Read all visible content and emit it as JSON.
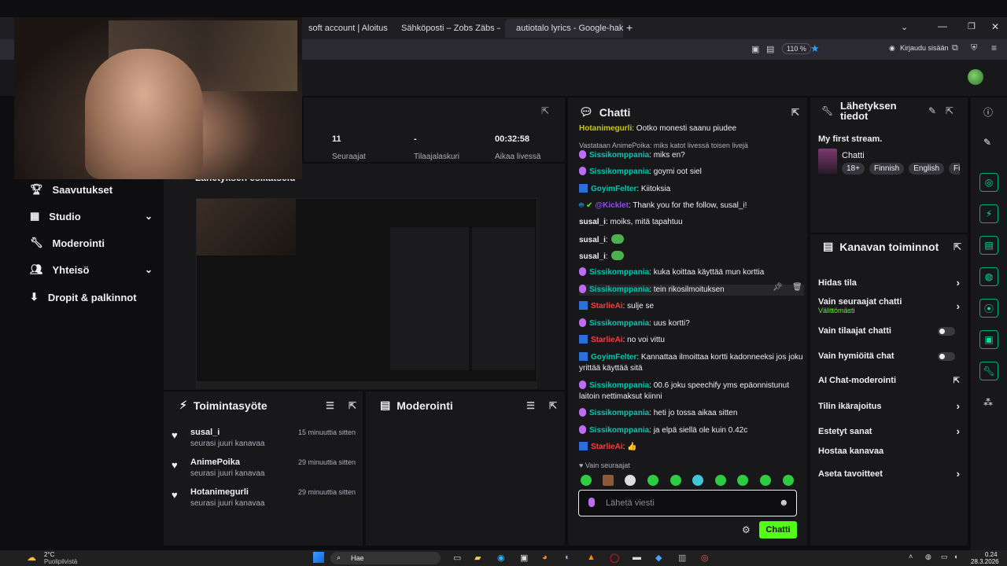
{
  "browser": {
    "tabs": [
      {
        "label": "soft account | Aloitus",
        "icon": "microsoft-icon"
      },
      {
        "label": "Sähköposti – Zobs Zäbs – Outlo",
        "icon": "outlook-icon"
      },
      {
        "label": "autiotalo lyrics - Google-haku",
        "icon": "google-icon"
      }
    ],
    "zoom": "110 %",
    "signin_label": "Kirjaudu sisään"
  },
  "stats": [
    {
      "value": "11",
      "label": "Seuraajat"
    },
    {
      "value": "-",
      "label": "Tilaajalaskuri"
    },
    {
      "value": "00:32:58",
      "label": "Aikaa livessä"
    }
  ],
  "preview_title": "Lähetyksen esikatselu",
  "sidebar": {
    "items": [
      {
        "label": "Saavutukset",
        "icon": "trophy-icon",
        "chevron": false
      },
      {
        "label": "Studio",
        "icon": "studio-icon",
        "chevron": true
      },
      {
        "label": "Moderointi",
        "icon": "wrench-icon",
        "chevron": false
      },
      {
        "label": "Yhteisö",
        "icon": "community-icon",
        "chevron": true
      },
      {
        "label": "Dropit & palkinnot",
        "icon": "drops-icon",
        "chevron": false
      }
    ]
  },
  "activity": {
    "title": "Toimintasyöte",
    "items": [
      {
        "user": "susal_i",
        "text": "seurasi juuri kanavaa",
        "time": "15 minuuttia sitten"
      },
      {
        "user": "AnimePoika",
        "text": "seurasi juuri kanavaa",
        "time": "29 minuuttia sitten"
      },
      {
        "user": "Hotanimegurli",
        "text": "seurasi juuri kanavaa",
        "time": "29 minuuttia sitten"
      }
    ]
  },
  "moderation": {
    "title": "Moderointi"
  },
  "chat": {
    "title": "Chatti",
    "reply_context": "Vastataan AnimePoika: miks katot livessä toisen livejä",
    "messages": [
      {
        "user": "Hotanimegurli",
        "text": ": Ootko monesti saanu piudee",
        "color": "y",
        "badge": "none"
      },
      {
        "user": "Sissikomppania",
        "text": ": miks en?",
        "color": "g",
        "badge": "mic"
      },
      {
        "user": "Sissikomppania",
        "text": ": goymi oot siel",
        "color": "g",
        "badge": "mic"
      },
      {
        "user": "GoyimFelter",
        "text": ": Kiitoksia",
        "color": "g",
        "badge": "box"
      },
      {
        "user": "@Kicklet",
        "text": ": Thank you for the follow, susal_i!",
        "color": "p",
        "badge": "bot"
      },
      {
        "user": "susal_i",
        "text": ": moiks, mitä tapahtuu",
        "color": "w",
        "badge": "none"
      },
      {
        "user": "susal_i",
        "text": ":",
        "color": "w",
        "badge": "none"
      },
      {
        "user": "susal_i",
        "text": ":",
        "color": "w",
        "badge": "none"
      },
      {
        "user": "Sissikomppania",
        "text": ": kuka koittaa käyttää mun korttia",
        "color": "g",
        "badge": "mic"
      },
      {
        "user": "Sissikomppania",
        "text": ": tein rikosilmoituksen",
        "color": "g",
        "badge": "mic"
      },
      {
        "user": "StarlieAi",
        "text": ": sulje se",
        "color": "r",
        "badge": "box"
      },
      {
        "user": "Sissikomppania",
        "text": ": uus kortti?",
        "color": "g",
        "badge": "mic"
      },
      {
        "user": "StarlieAi",
        "text": ": no voi vittu",
        "color": "r",
        "badge": "box"
      },
      {
        "user": "GoyimFelter",
        "text": ": Kannattaa ilmoittaa kortti kadonneeksi jos joku yrittää käyttää sitä",
        "color": "g",
        "badge": "box"
      },
      {
        "user": "Sissikomppania",
        "text": ": 00.6 joku speechify yms epäonnistunut laitoin nettimaksut kiinni",
        "color": "g",
        "badge": "mic"
      },
      {
        "user": "Sissikomppania",
        "text": ": heti jo tossa aikaa sitten",
        "color": "g",
        "badge": "mic"
      },
      {
        "user": "Sissikomppania",
        "text": ": ja elpä siellä ole kuin 0.42c",
        "color": "g",
        "badge": "mic"
      },
      {
        "user": "StarlieAi",
        "text": ": 👍",
        "color": "r",
        "badge": "box"
      }
    ],
    "followers_only": "Vain seuraajat",
    "input_placeholder": "Lähetä viesti",
    "send_label": "Chatti"
  },
  "stream_info": {
    "title_line1": "Lähetyksen",
    "title_line2": "tiedot",
    "stream_name": "My first stream.",
    "category": "Chatti",
    "tags": [
      "18+",
      "Finnish",
      "English",
      "Fi"
    ]
  },
  "channel_actions": {
    "title": "Kanavan toiminnot",
    "rows": [
      {
        "label": "Hidas tila",
        "control": "chevron"
      },
      {
        "label": "Vain seuraajat chatti",
        "sub": "Välittömästi",
        "control": "chevron"
      },
      {
        "label": "Vain tilaajat chatti",
        "control": "toggle"
      },
      {
        "label": "Vain hymiöitä chat",
        "control": "toggle"
      },
      {
        "label": "AI Chat-moderointi",
        "control": "external"
      },
      {
        "label": "Tilin ikärajoitus",
        "control": "chevron"
      },
      {
        "label": "Estetyt sanat",
        "control": "chevron"
      },
      {
        "label": "Hostaa kanavaa",
        "control": "none"
      },
      {
        "label": "Aseta tavoitteet",
        "control": "chevron"
      }
    ]
  },
  "taskbar": {
    "weather": "2°C",
    "weather_sub": "Puolipilvistä",
    "search": "Hae",
    "time": "0.24",
    "date": "28.3.2026"
  },
  "colors": {
    "accent": "#53fc18",
    "panel": "#18181b",
    "bg": "#0e0e10"
  }
}
